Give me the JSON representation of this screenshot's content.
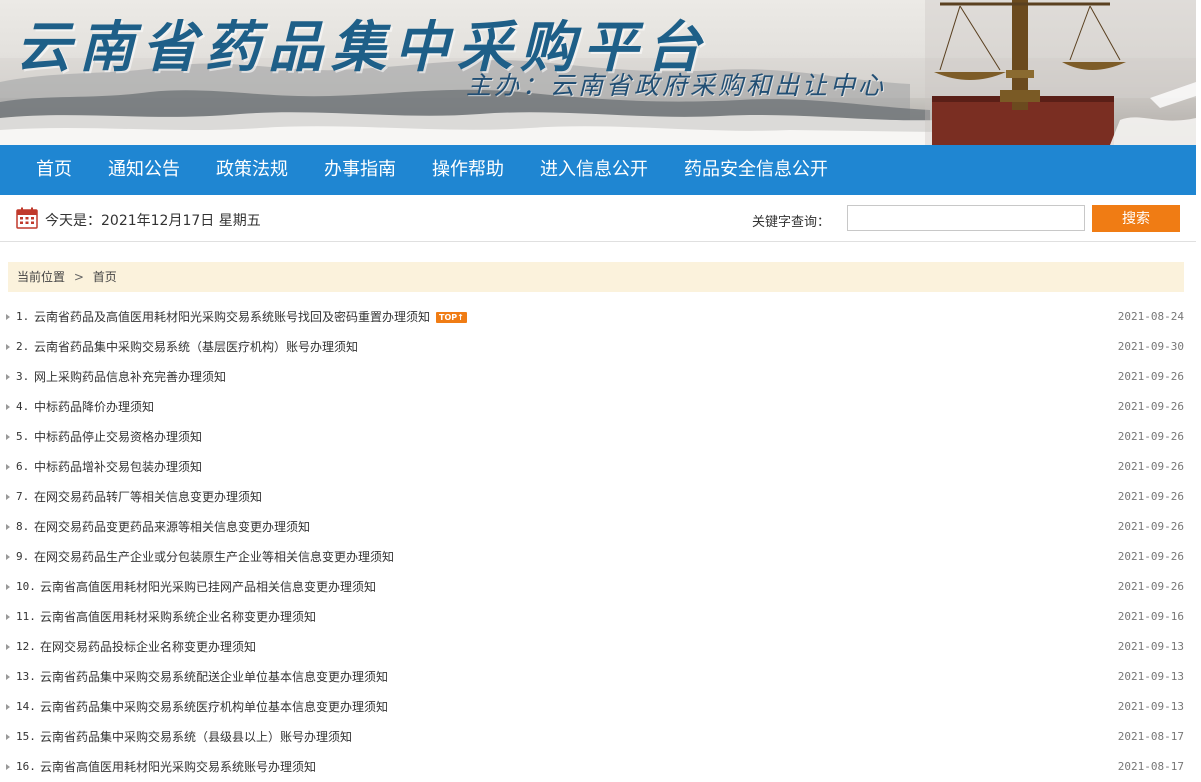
{
  "banner": {
    "title": "云南省药品集中采购平台",
    "sponsor": "主办：云南省政府采购和出让中心"
  },
  "nav": [
    {
      "label": "首页"
    },
    {
      "label": "通知公告"
    },
    {
      "label": "政策法规"
    },
    {
      "label": "办事指南"
    },
    {
      "label": "操作帮助"
    },
    {
      "label": "进入信息公开"
    },
    {
      "label": "药品安全信息公开"
    }
  ],
  "infobar": {
    "date_text": "今天是：2021年12月17日 星期五",
    "keyword_label": "关键字查询：",
    "search_value": "",
    "search_button": "搜索"
  },
  "breadcrumb": {
    "label": "当前位置",
    "separator": ">",
    "current": "首页"
  },
  "notices": [
    {
      "num": "1.",
      "title": "云南省药品及高值医用耗材阳光采购交易系统账号找回及密码重置办理须知",
      "badge": "TOP↑",
      "date": "2021-08-24"
    },
    {
      "num": "2.",
      "title": "云南省药品集中采购交易系统（基层医疗机构）账号办理须知",
      "date": "2021-09-30"
    },
    {
      "num": "3.",
      "title": "网上采购药品信息补充完善办理须知",
      "date": "2021-09-26"
    },
    {
      "num": "4.",
      "title": "中标药品降价办理须知",
      "date": "2021-09-26"
    },
    {
      "num": "5.",
      "title": "中标药品停止交易资格办理须知",
      "date": "2021-09-26"
    },
    {
      "num": "6.",
      "title": "中标药品增补交易包装办理须知",
      "date": "2021-09-26"
    },
    {
      "num": "7.",
      "title": "在网交易药品转厂等相关信息变更办理须知",
      "date": "2021-09-26"
    },
    {
      "num": "8.",
      "title": "在网交易药品变更药品来源等相关信息变更办理须知",
      "date": "2021-09-26"
    },
    {
      "num": "9.",
      "title": "在网交易药品生产企业或分包装原生产企业等相关信息变更办理须知",
      "date": "2021-09-26"
    },
    {
      "num": "10.",
      "title": "云南省高值医用耗材阳光采购已挂网产品相关信息变更办理须知",
      "date": "2021-09-26"
    },
    {
      "num": "11.",
      "title": "云南省高值医用耗材采购系统企业名称变更办理须知",
      "date": "2021-09-16"
    },
    {
      "num": "12.",
      "title": "在网交易药品投标企业名称变更办理须知",
      "date": "2021-09-13"
    },
    {
      "num": "13.",
      "title": "云南省药品集中采购交易系统配送企业单位基本信息变更办理须知",
      "date": "2021-09-13"
    },
    {
      "num": "14.",
      "title": "云南省药品集中采购交易系统医疗机构单位基本信息变更办理须知",
      "date": "2021-09-13"
    },
    {
      "num": "15.",
      "title": "云南省药品集中采购交易系统（县级县以上）账号办理须知",
      "date": "2021-08-17"
    },
    {
      "num": "16.",
      "title": "云南省高值医用耗材阳光采购交易系统账号办理须知",
      "date": "2021-08-17"
    }
  ]
}
